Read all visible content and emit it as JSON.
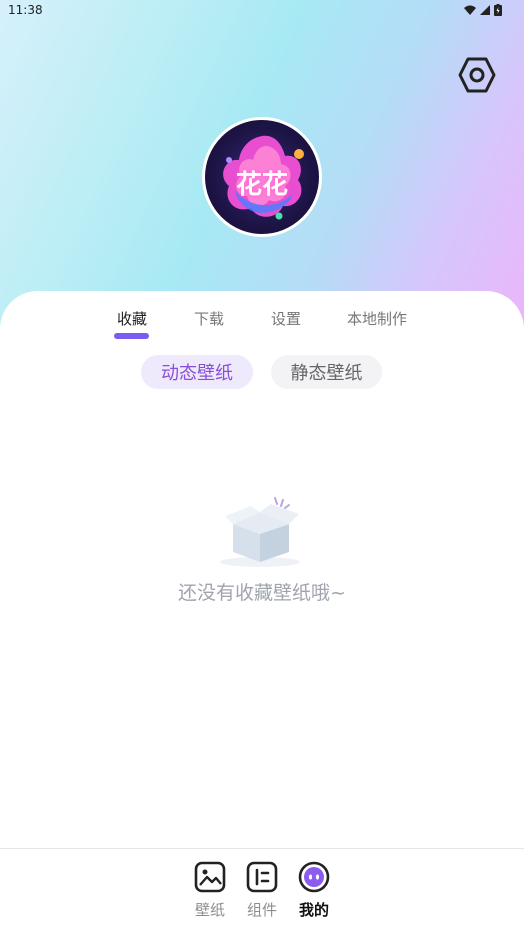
{
  "status_bar": {
    "time": "11:38"
  },
  "profile": {
    "avatar_text": "花花"
  },
  "tabs": [
    {
      "label": "收藏",
      "active": true
    },
    {
      "label": "下载",
      "active": false
    },
    {
      "label": "设置",
      "active": false
    },
    {
      "label": "本地制作",
      "active": false
    }
  ],
  "filters": {
    "dynamic": "动态壁纸",
    "static": "静态壁纸",
    "selected": "动态壁纸"
  },
  "empty_state": {
    "message": "还没有收藏壁纸哦~"
  },
  "bottom_nav": {
    "items": [
      {
        "label": "壁纸",
        "icon": "image-icon",
        "active": false
      },
      {
        "label": "组件",
        "icon": "widget-icon",
        "active": false
      },
      {
        "label": "我的",
        "icon": "face-icon",
        "active": true
      }
    ]
  },
  "colors": {
    "accent": "#7b5cf0",
    "chip_text": "#8a4fd9"
  }
}
